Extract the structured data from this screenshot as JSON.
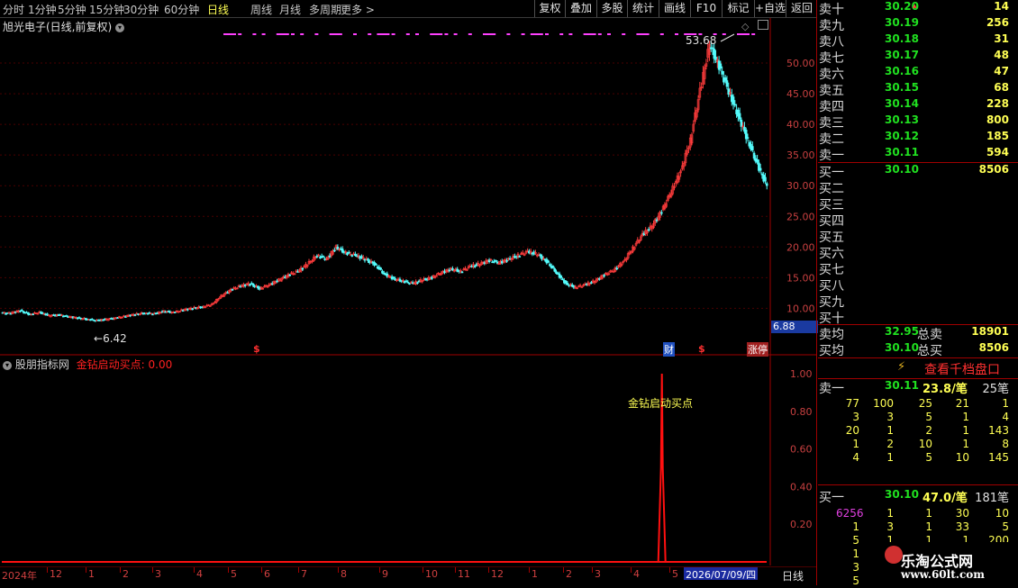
{
  "toolbar": {
    "periods": [
      "分时",
      "1分钟",
      "5分钟",
      "15分钟",
      "30分钟",
      "60分钟",
      "日线",
      "周线",
      "月线",
      "多周期",
      "更多"
    ],
    "active_period": "日线",
    "right_buttons": [
      "复权",
      "叠加",
      "多股",
      "统计",
      "画线",
      "F10",
      "标记",
      "+自选",
      "返回"
    ]
  },
  "main_chart": {
    "title": "旭光电子(日线,前复权)",
    "high_label": "53.68",
    "low_label": "6.42",
    "last_price_tag": "6.88",
    "markers": [
      "$",
      "财",
      "$",
      "涨停"
    ]
  },
  "indicator": {
    "name": "股朋指标网",
    "signal_text": "金钻启动买点: 0.00",
    "annotation": "金钻启动买点",
    "y_ticks": [
      "1.00",
      "0.80",
      "0.60",
      "0.40",
      "0.20"
    ]
  },
  "bottom_axis": {
    "year_label": "2024年",
    "months": [
      "12",
      "1",
      "2",
      "3",
      "4",
      "5",
      "6",
      "7",
      "8",
      "9",
      "10",
      "11",
      "12",
      "1",
      "2",
      "3",
      "4",
      "5"
    ],
    "cursor_date": "2026/07/09/四",
    "period_tab": "日线"
  },
  "chart_data": {
    "type": "candlestick",
    "ylim": [
      8,
      55
    ],
    "y_ticks": [
      10,
      15,
      20,
      25,
      30,
      35,
      40,
      45,
      50
    ],
    "indicator_ylim": [
      0,
      1
    ],
    "signal_spike_index": 0.862,
    "close_series": [
      9.8,
      10.2,
      9.6,
      9.9,
      9.4,
      9.5,
      9.2,
      9.0,
      8.8,
      8.6,
      8.8,
      9.0,
      9.3,
      9.6,
      9.8,
      9.7,
      10.1,
      9.9,
      10.3,
      10.6,
      10.8,
      11.2,
      12.6,
      13.6,
      14.2,
      14.6,
      13.8,
      14.4,
      15.2,
      16.0,
      16.6,
      17.8,
      19.2,
      18.6,
      20.6,
      19.6,
      19.2,
      18.6,
      17.8,
      16.2,
      15.4,
      15.0,
      14.6,
      15.2,
      15.6,
      16.4,
      17.0,
      16.6,
      17.4,
      17.8,
      18.4,
      18.0,
      18.6,
      19.2,
      19.8,
      19.4,
      18.2,
      16.4,
      14.6,
      14.0,
      14.4,
      15.0,
      16.0,
      16.8,
      18.2,
      20.4,
      22.6,
      24.0,
      26.4,
      29.6,
      33.0,
      38.0,
      46.0,
      53.6,
      50.0,
      46.0,
      42.0,
      38.0,
      34.0,
      30.5
    ]
  },
  "orderbook": {
    "sell": [
      {
        "label": "卖十",
        "price": "30.20",
        "vol": "14"
      },
      {
        "label": "卖九",
        "price": "30.19",
        "vol": "256"
      },
      {
        "label": "卖八",
        "price": "30.18",
        "vol": "31"
      },
      {
        "label": "卖七",
        "price": "30.17",
        "vol": "48"
      },
      {
        "label": "卖六",
        "price": "30.16",
        "vol": "47"
      },
      {
        "label": "卖五",
        "price": "30.15",
        "vol": "68"
      },
      {
        "label": "卖四",
        "price": "30.14",
        "vol": "228"
      },
      {
        "label": "卖三",
        "price": "30.13",
        "vol": "800"
      },
      {
        "label": "卖二",
        "price": "30.12",
        "vol": "185"
      },
      {
        "label": "卖一",
        "price": "30.11",
        "vol": "594"
      }
    ],
    "buy": [
      {
        "label": "买一",
        "price": "30.10",
        "vol": "8506"
      },
      {
        "label": "买二",
        "price": "",
        "vol": ""
      },
      {
        "label": "买三",
        "price": "",
        "vol": ""
      },
      {
        "label": "买四",
        "price": "",
        "vol": ""
      },
      {
        "label": "买五",
        "price": "",
        "vol": ""
      },
      {
        "label": "买六",
        "price": "",
        "vol": ""
      },
      {
        "label": "买七",
        "price": "",
        "vol": ""
      },
      {
        "label": "买八",
        "price": "",
        "vol": ""
      },
      {
        "label": "买九",
        "price": "",
        "vol": ""
      },
      {
        "label": "买十",
        "price": "",
        "vol": ""
      }
    ],
    "avg_sell_label": "卖均",
    "avg_sell": "32.95",
    "total_sell_label": "总卖",
    "total_sell": "18901",
    "avg_buy_label": "买均",
    "avg_buy": "30.10",
    "total_buy_label": "总买",
    "total_buy": "8506",
    "thousand_button": "查看千档盘口"
  },
  "ticks": {
    "sell_label": "卖一",
    "sell_price": "30.11",
    "sell_per": "23.8/笔",
    "sell_count": "25笔",
    "sell_rows": [
      [
        "77",
        "100",
        "25",
        "21",
        "1"
      ],
      [
        "3",
        "3",
        "5",
        "1",
        "4"
      ],
      [
        "20",
        "1",
        "2",
        "1",
        "143"
      ],
      [
        "1",
        "2",
        "10",
        "1",
        "8"
      ],
      [
        "4",
        "1",
        "5",
        "10",
        "145"
      ]
    ],
    "buy_label": "买一",
    "buy_price": "30.10",
    "buy_per": "47.0/笔",
    "buy_count": "181笔",
    "buy_rows": [
      [
        "6256",
        "1",
        "1",
        "30",
        "10"
      ],
      [
        "1",
        "3",
        "1",
        "33",
        "5"
      ],
      [
        "5",
        "1",
        "1",
        "1",
        "200"
      ],
      [
        "1",
        "",
        "",
        "",
        ""
      ],
      [
        "3",
        "",
        "",
        "",
        ""
      ],
      [
        "5",
        "",
        "",
        "",
        ""
      ]
    ]
  },
  "watermark": {
    "name": "乐淘公式网",
    "url": "www.60lt.com"
  },
  "colors": {
    "up": "#ff3c3c",
    "down": "#54fcfc",
    "sell_price": "#20e020",
    "vol": "#ffff54",
    "indicator": "#ff1010",
    "magenta": "#ff40ff"
  }
}
